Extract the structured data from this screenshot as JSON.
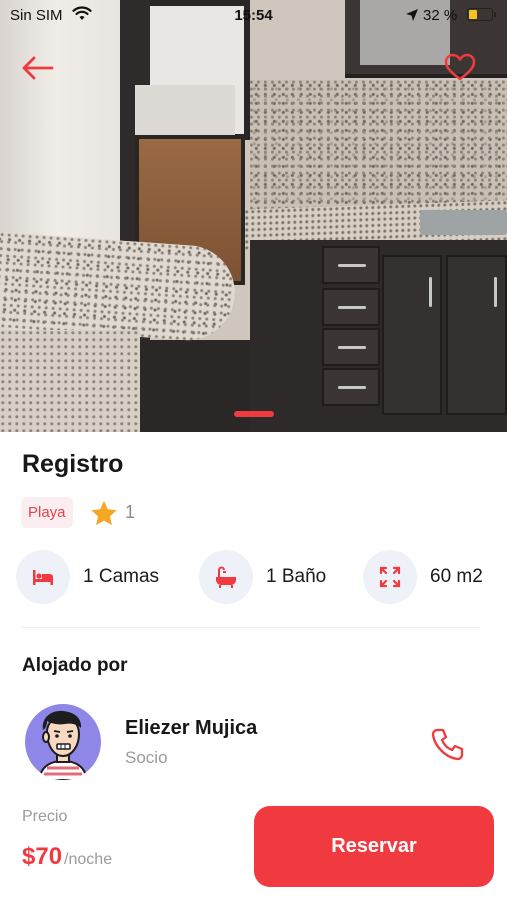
{
  "status_bar": {
    "carrier": "Sin SIM",
    "time": "15:54",
    "battery_percent": "32 %"
  },
  "listing": {
    "title": "Registro",
    "tag": "Playa",
    "rating": "1",
    "image_index": 1
  },
  "features": [
    {
      "icon": "bed-icon",
      "label": "1 Camas"
    },
    {
      "icon": "bathtub-icon",
      "label": "1 Baño"
    },
    {
      "icon": "area-expand-icon",
      "label": "60 m2"
    }
  ],
  "host": {
    "section_title": "Alojado por",
    "name": "Eliezer Mujica",
    "role": "Socio"
  },
  "booking": {
    "price_label": "Precio",
    "price": "$70",
    "price_unit": "/noche",
    "button_label": "Reservar"
  },
  "colors": {
    "accent": "#f03a3f",
    "tag_bg": "#fbeef0",
    "icon_circle": "#eef2f8",
    "star": "#f5a623",
    "avatar_bg": "#8f87e8"
  }
}
